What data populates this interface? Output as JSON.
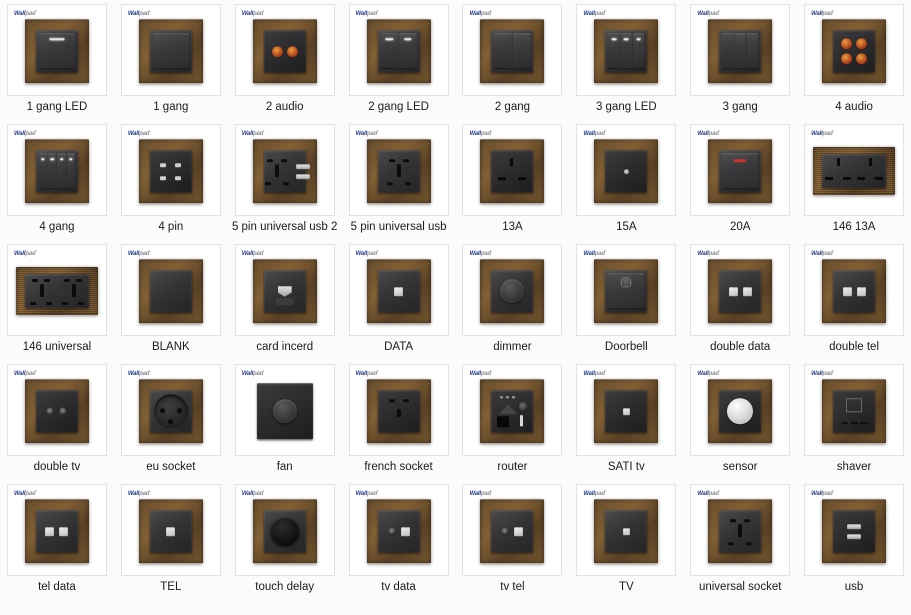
{
  "page": {
    "title": "Wallpad wall switch and socket product catalogue grid",
    "background_color": "#fbfbfb",
    "card_background": "#ffffff",
    "card_border_color": "#e2e2e2",
    "label_color": "#1b1b1b",
    "columns": 8,
    "rows": 5,
    "total_items": 40
  },
  "brand": {
    "part1": "Wall",
    "part2": "pad",
    "part3": "·",
    "color_primary": "#2b3f8c",
    "color_secondary": "#8e8e8e"
  },
  "products": [
    {
      "label": "1 gang LED",
      "style": "rocker",
      "count": 1,
      "led": true
    },
    {
      "label": "1 gang",
      "style": "rocker",
      "count": 1,
      "led": false
    },
    {
      "label": "2 audio",
      "style": "audio2",
      "count": 2
    },
    {
      "label": "2 gang LED",
      "style": "rocker",
      "count": 2,
      "led": true
    },
    {
      "label": "2 gang",
      "style": "rocker",
      "count": 2,
      "led": false
    },
    {
      "label": "3 gang LED",
      "style": "rocker",
      "count": 3,
      "led": true
    },
    {
      "label": "3 gang",
      "style": "rocker",
      "count": 3,
      "led": false
    },
    {
      "label": "4 audio",
      "style": "audio4",
      "count": 4
    },
    {
      "label": "4 gang",
      "style": "rocker",
      "count": 4,
      "led": true
    },
    {
      "label": "4 pin",
      "style": "pin4"
    },
    {
      "label": "5 pin universal usb 2",
      "style": "uni-usb"
    },
    {
      "label": "5 pin universal usb",
      "style": "uni"
    },
    {
      "label": "13A",
      "style": "uk13"
    },
    {
      "label": "15A",
      "style": "uk15"
    },
    {
      "label": "20A",
      "style": "rocker",
      "count": 1,
      "redled": true
    },
    {
      "label": "146 13A",
      "style": "wide13"
    },
    {
      "label": "146 universal",
      "style": "wideuni"
    },
    {
      "label": "BLANK",
      "style": "blank"
    },
    {
      "label": "card incerd",
      "style": "card"
    },
    {
      "label": "DATA",
      "style": "data1"
    },
    {
      "label": "dimmer",
      "style": "dimmer"
    },
    {
      "label": "Doorbell",
      "style": "doorbell"
    },
    {
      "label": "double data",
      "style": "data2"
    },
    {
      "label": "double tel",
      "style": "tel2"
    },
    {
      "label": "double tv",
      "style": "tv2"
    },
    {
      "label": "eu socket",
      "style": "eu"
    },
    {
      "label": "fan",
      "style": "fan"
    },
    {
      "label": "french socket",
      "style": "french"
    },
    {
      "label": "router",
      "style": "router"
    },
    {
      "label": "SATI tv",
      "style": "sat"
    },
    {
      "label": "sensor",
      "style": "sensor"
    },
    {
      "label": "shaver",
      "style": "shaver"
    },
    {
      "label": "tel data",
      "style": "data2"
    },
    {
      "label": "TEL",
      "style": "data1"
    },
    {
      "label": "touch delay",
      "style": "touch"
    },
    {
      "label": "tv data",
      "style": "tvdata"
    },
    {
      "label": "tv tel",
      "style": "tvdata"
    },
    {
      "label": "TV",
      "style": "tv1"
    },
    {
      "label": "universal socket",
      "style": "uni"
    },
    {
      "label": "usb",
      "style": "usb"
    }
  ]
}
